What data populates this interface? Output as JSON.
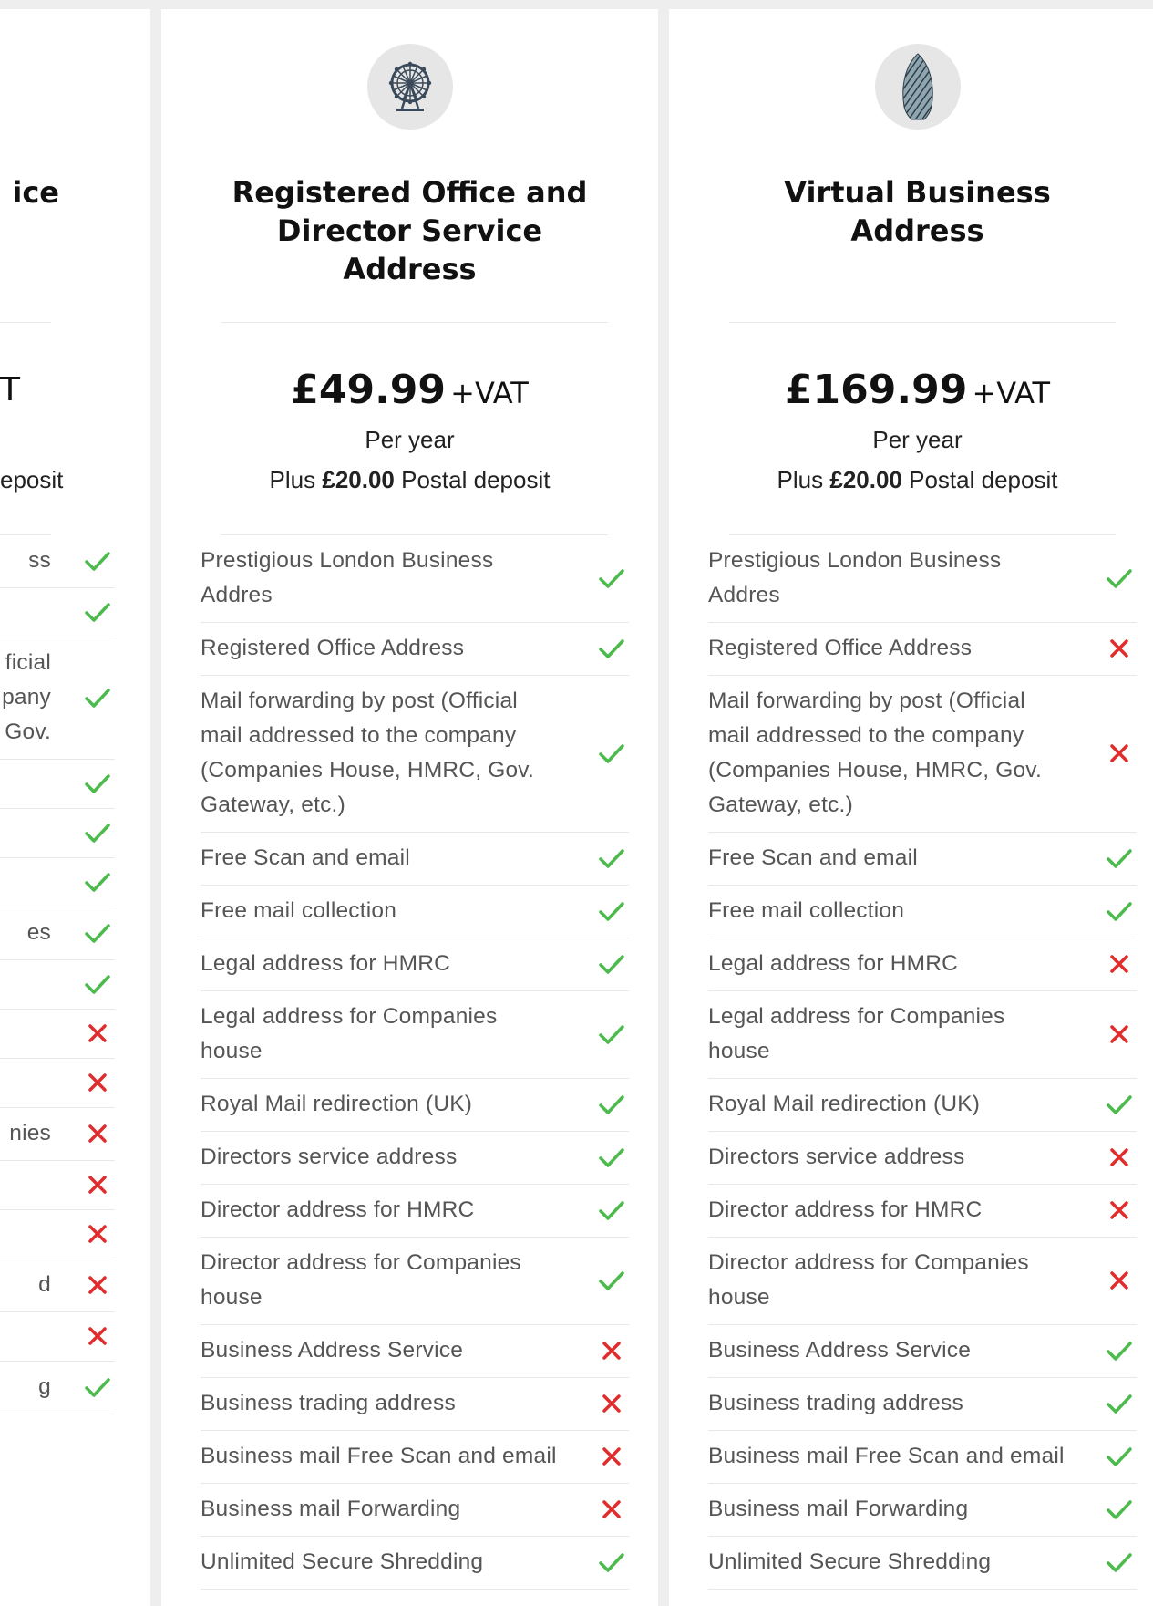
{
  "colors": {
    "check": "#4cba4c",
    "cross": "#e12c2c",
    "page_bg": "#eeeeee",
    "card_bg": "#ffffff"
  },
  "plans": [
    {
      "icon": "icon-partial",
      "title_lines": [
        "ice"
      ],
      "price_amount": "",
      "price_vat": "T",
      "period": "",
      "deposit_prefix": "",
      "deposit_amount": "",
      "deposit_suffix": "eposit",
      "features": [
        {
          "label": "ss",
          "included": true
        },
        {
          "label": "",
          "included": true
        },
        {
          "label": "ficial\npany\nGov.",
          "included": true
        },
        {
          "label": "",
          "included": true
        },
        {
          "label": "",
          "included": true
        },
        {
          "label": "",
          "included": true
        },
        {
          "label": "es",
          "included": true
        },
        {
          "label": "",
          "included": true
        },
        {
          "label": "",
          "included": false
        },
        {
          "label": "",
          "included": false
        },
        {
          "label": "nies",
          "included": false
        },
        {
          "label": "",
          "included": false
        },
        {
          "label": "",
          "included": false
        },
        {
          "label": "d",
          "included": false
        },
        {
          "label": "",
          "included": false
        },
        {
          "label": "g",
          "included": true
        }
      ]
    },
    {
      "icon": "ferris-wheel-icon",
      "title_lines": [
        "Registered Office and",
        "Director Service",
        "Address"
      ],
      "price_amount": "£49.99",
      "price_vat": "+VAT",
      "period": "Per year",
      "deposit_prefix": "Plus",
      "deposit_amount": "£20.00",
      "deposit_suffix": "Postal deposit",
      "features": [
        {
          "label": "Prestigious London Business Addres",
          "included": true
        },
        {
          "label": "Registered Office Address",
          "included": true
        },
        {
          "label": "Mail forwarding by post (Official mail addressed to the company (Companies House, HMRC, Gov. Gateway, etc.)",
          "included": true
        },
        {
          "label": "Free Scan and email",
          "included": true
        },
        {
          "label": "Free mail collection",
          "included": true
        },
        {
          "label": "Legal address for HMRC",
          "included": true
        },
        {
          "label": "Legal address for Companies house",
          "included": true
        },
        {
          "label": "Royal Mail redirection (UK)",
          "included": true
        },
        {
          "label": "Directors service address",
          "included": true
        },
        {
          "label": "Director address for HMRC",
          "included": true
        },
        {
          "label": "Director address for Companies house",
          "included": true
        },
        {
          "label": "Business Address Service",
          "included": false
        },
        {
          "label": "Business trading address",
          "included": false
        },
        {
          "label": "Business mail Free Scan and email",
          "included": false
        },
        {
          "label": "Business mail Forwarding",
          "included": false
        },
        {
          "label": "Unlimited Secure Shredding",
          "included": true
        }
      ]
    },
    {
      "icon": "gherkin-building-icon",
      "title_lines": [
        "Virtual Business",
        "Address"
      ],
      "price_amount": "£169.99",
      "price_vat": "+VAT",
      "period": "Per year",
      "deposit_prefix": "Plus",
      "deposit_amount": "£20.00",
      "deposit_suffix": "Postal deposit",
      "features": [
        {
          "label": "Prestigious London Business Addres",
          "included": true
        },
        {
          "label": "Registered Office Address",
          "included": false
        },
        {
          "label": "Mail forwarding by post (Official mail addressed to the company (Companies House, HMRC, Gov. Gateway, etc.)",
          "included": false
        },
        {
          "label": "Free Scan and email",
          "included": true
        },
        {
          "label": "Free mail collection",
          "included": true
        },
        {
          "label": "Legal address for HMRC",
          "included": false
        },
        {
          "label": "Legal address for Companies house",
          "included": false
        },
        {
          "label": "Royal Mail redirection (UK)",
          "included": true
        },
        {
          "label": "Directors service address",
          "included": false
        },
        {
          "label": "Director address for HMRC",
          "included": false
        },
        {
          "label": "Director address for Companies house",
          "included": false
        },
        {
          "label": "Business Address Service",
          "included": true
        },
        {
          "label": "Business trading address",
          "included": true
        },
        {
          "label": "Business mail Free Scan and email",
          "included": true
        },
        {
          "label": "Business mail Forwarding",
          "included": true
        },
        {
          "label": "Unlimited Secure Shredding",
          "included": true
        }
      ]
    }
  ]
}
